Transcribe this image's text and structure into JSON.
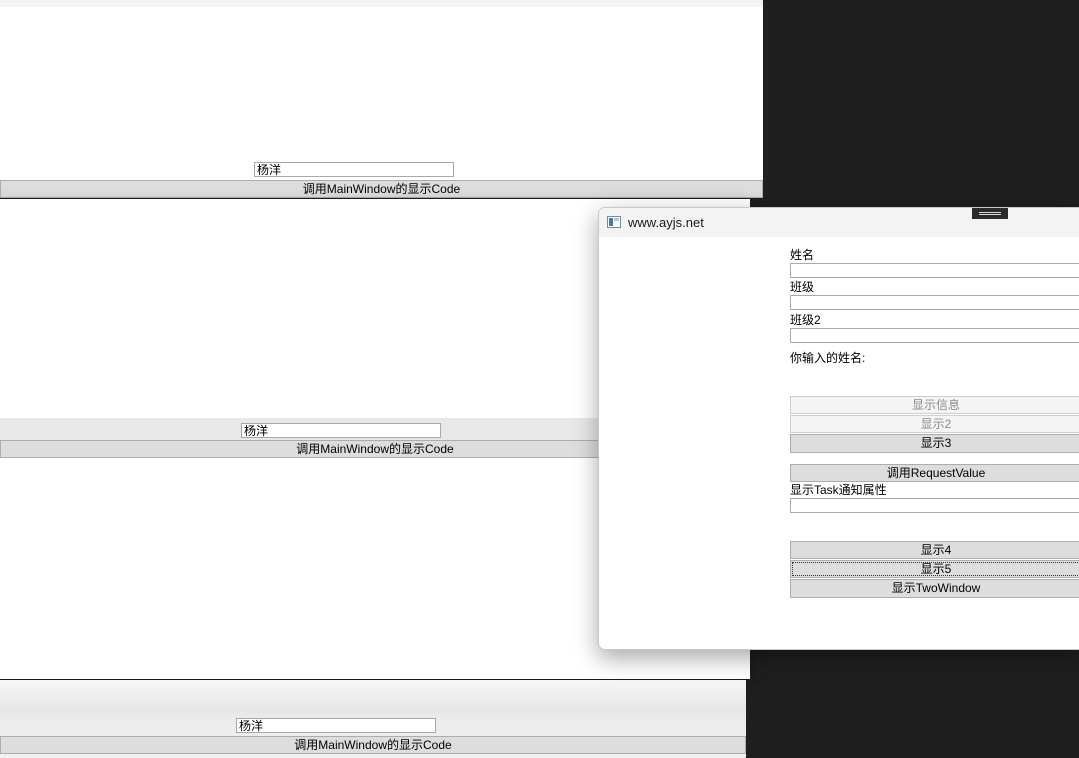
{
  "main_windows": [
    {
      "name_value": "杨洋",
      "call_button_label": "调用MainWindow的显示Code"
    },
    {
      "name_value": "杨洋",
      "call_button_label": "调用MainWindow的显示Code"
    },
    {
      "name_value": "杨洋",
      "call_button_label": "调用MainWindow的显示Code"
    }
  ],
  "dialog": {
    "title": "www.ayjs.net",
    "name_label": "姓名",
    "name_value": "",
    "class_label": "班级",
    "class_value": "",
    "class2_label": "班级2",
    "class2_value": "",
    "entered_name_label": "你输入的姓名:",
    "buttons": {
      "show_info": "显示信息",
      "show2": "显示2",
      "show3": "显示3",
      "request_value": "调用RequestValue",
      "show4": "显示4",
      "show5": "显示5",
      "show_two_window": "显示TwoWindow"
    },
    "task_label": "显示Task通知属性",
    "task_value": ""
  }
}
